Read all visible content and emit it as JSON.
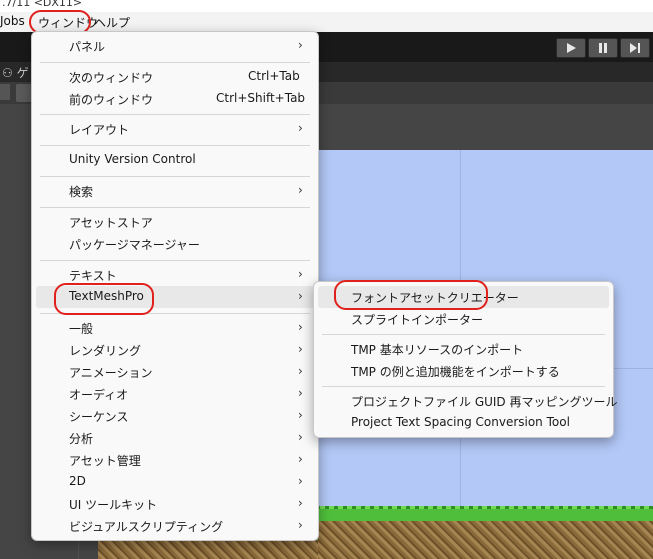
{
  "title_strip": ".7/11 <DX11>",
  "menubar": {
    "jobs": "Jobs",
    "window": "ウィンドウ",
    "help": "ヘルプ"
  },
  "tab": {
    "label": "ゲ"
  },
  "window_menu": {
    "items": [
      {
        "label": "パネル",
        "submenu": true
      },
      {
        "label": "次のウィンドウ",
        "shortcut": "Ctrl+Tab"
      },
      {
        "label": "前のウィンドウ",
        "shortcut": "Ctrl+Shift+Tab"
      },
      {
        "label": "レイアウト",
        "submenu": true
      },
      {
        "label": "Unity Version Control"
      },
      {
        "label": "検索",
        "submenu": true
      },
      {
        "label": "アセットストア"
      },
      {
        "label": "パッケージマネージャー"
      },
      {
        "label": "テキスト",
        "submenu": true
      },
      {
        "label": "TextMeshPro",
        "submenu": true,
        "highlighted": true
      },
      {
        "label": "一般",
        "submenu": true
      },
      {
        "label": "レンダリング",
        "submenu": true
      },
      {
        "label": "アニメーション",
        "submenu": true
      },
      {
        "label": "オーディオ",
        "submenu": true
      },
      {
        "label": "シーケンス",
        "submenu": true
      },
      {
        "label": "分析",
        "submenu": true
      },
      {
        "label": "アセット管理",
        "submenu": true
      },
      {
        "label": "2D",
        "submenu": true
      },
      {
        "label": "UI ツールキット",
        "submenu": true
      },
      {
        "label": "ビジュアルスクリプティング",
        "submenu": true
      }
    ]
  },
  "tmp_submenu": {
    "items": [
      {
        "label": "フォントアセットクリエーター",
        "highlighted": true
      },
      {
        "label": "スプライトインポーター"
      },
      {
        "label": "TMP 基本リソースのインポート"
      },
      {
        "label": "TMP の例と追加機能をインポートする"
      },
      {
        "label": "プロジェクトファイル GUID 再マッピングツール"
      },
      {
        "label": "Project Text Spacing Conversion Tool"
      }
    ]
  },
  "icons": {
    "arrow": "›",
    "play": "play-icon",
    "pause": "pause-icon",
    "step": "step-icon"
  },
  "colors": {
    "annotation": "#e0201c",
    "menu_bg": "#f9f9f9",
    "highlight": "#e8e8e8",
    "sky": "#b3c8f7"
  }
}
